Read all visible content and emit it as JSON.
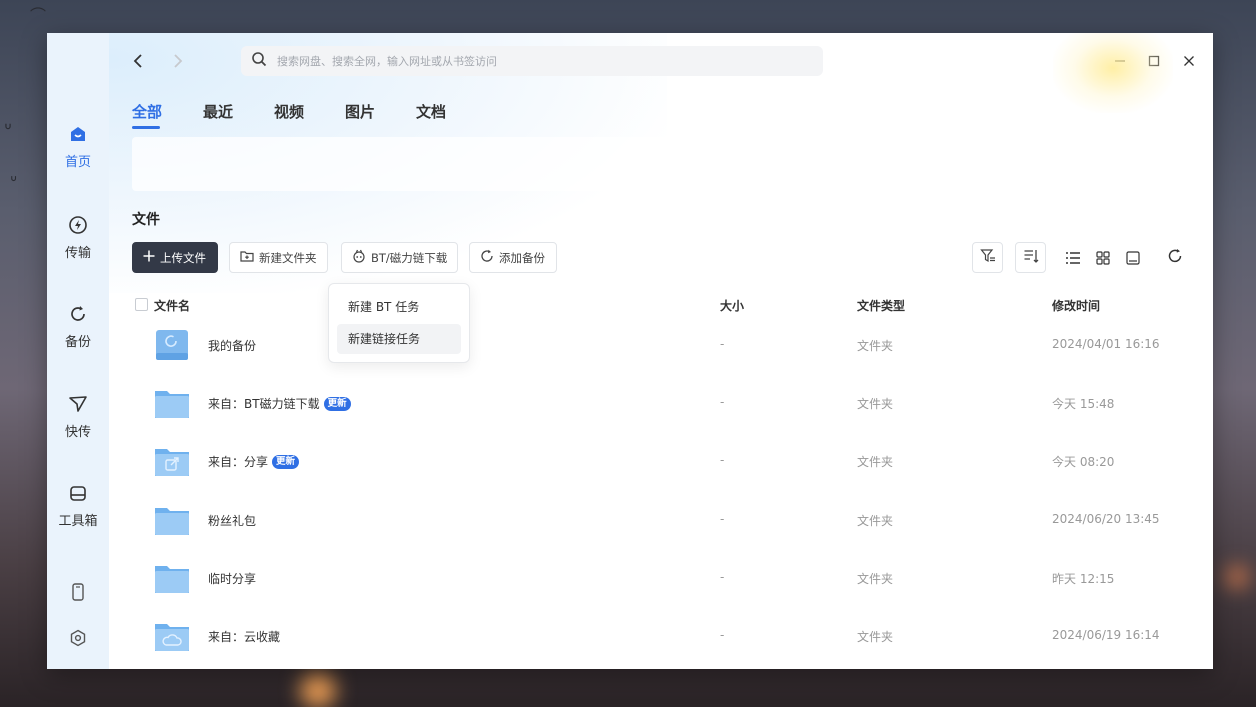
{
  "sidebar": {
    "items": [
      {
        "label": "首页",
        "icon": "home-icon"
      },
      {
        "label": "传输",
        "icon": "transfer-icon"
      },
      {
        "label": "备份",
        "icon": "backup-icon"
      },
      {
        "label": "快传",
        "icon": "send-icon"
      },
      {
        "label": "工具箱",
        "icon": "toolbox-icon"
      }
    ],
    "bottom": [
      {
        "icon": "phone-icon"
      },
      {
        "icon": "settings-icon"
      }
    ]
  },
  "header": {
    "search_placeholder": "搜索网盘、搜索全网，输入网址或从书签访问"
  },
  "tabs": [
    {
      "label": "全部"
    },
    {
      "label": "最近"
    },
    {
      "label": "视频"
    },
    {
      "label": "图片"
    },
    {
      "label": "文档"
    }
  ],
  "section_title": "文件",
  "toolbar": {
    "upload": "上传文件",
    "new_folder": "新建文件夹",
    "bt_download": "BT/磁力链下载",
    "add_backup": "添加备份"
  },
  "dropdown": {
    "items": [
      {
        "label": "新建 BT 任务"
      },
      {
        "label": "新建链接任务"
      }
    ]
  },
  "columns": {
    "name": "文件名",
    "size": "大小",
    "type": "文件类型",
    "modified": "修改时间"
  },
  "files": [
    {
      "name": "我的备份",
      "badge": "",
      "size": "-",
      "type": "文件夹",
      "modified": "2024/04/01 16:16",
      "icon": "backup-drive-icon"
    },
    {
      "name": "来自：BT磁力链下载",
      "badge": "更新",
      "size": "-",
      "type": "文件夹",
      "modified": "今天 15:48",
      "icon": "folder-icon"
    },
    {
      "name": "来自：分享",
      "badge": "更新",
      "size": "-",
      "type": "文件夹",
      "modified": "今天 08:20",
      "icon": "share-folder-icon"
    },
    {
      "name": "粉丝礼包",
      "badge": "",
      "size": "-",
      "type": "文件夹",
      "modified": "2024/06/20 13:45",
      "icon": "folder-icon"
    },
    {
      "name": "临时分享",
      "badge": "",
      "size": "-",
      "type": "文件夹",
      "modified": "昨天 12:15",
      "icon": "folder-icon"
    },
    {
      "name": "来自：云收藏",
      "badge": "",
      "size": "-",
      "type": "文件夹",
      "modified": "2024/06/19 16:14",
      "icon": "cloud-folder-icon"
    }
  ],
  "colors": {
    "accent": "#2f6fe4",
    "primary_button": "#333947",
    "folder": "#8ec5f5"
  }
}
